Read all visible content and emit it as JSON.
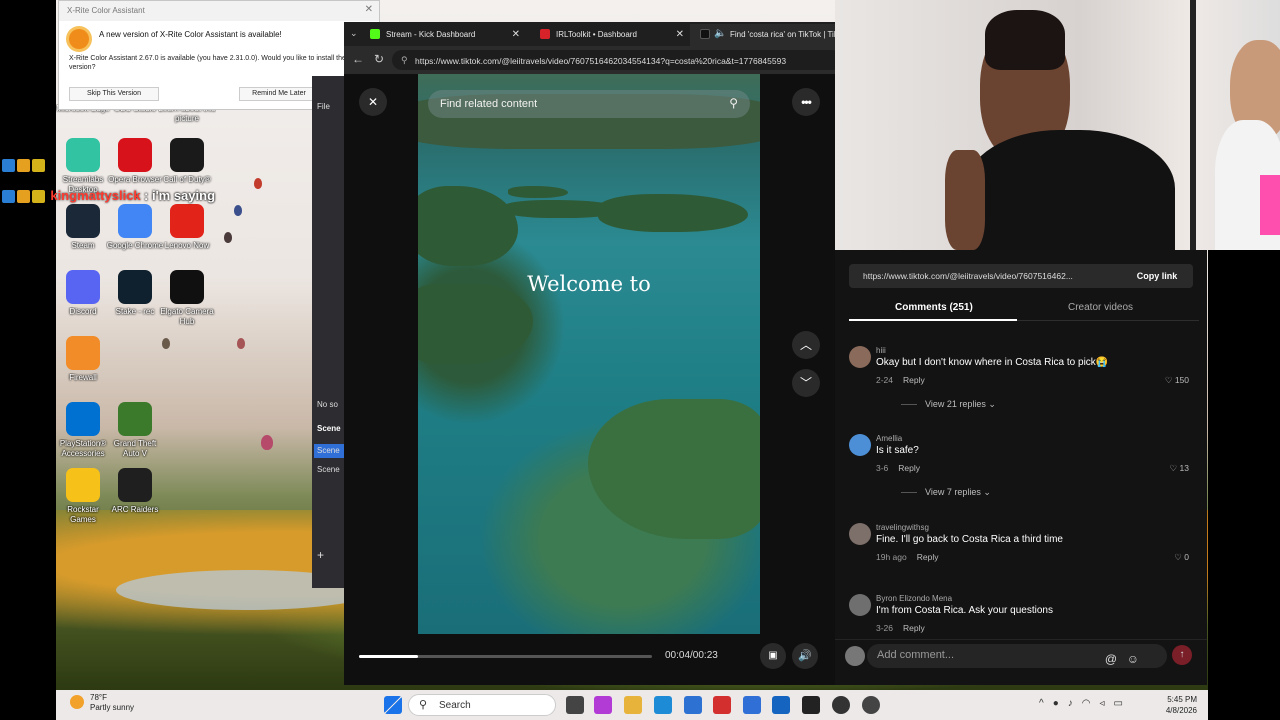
{
  "xrite_popup": {
    "title": "X-Rite Color Assistant",
    "headline": "A new version of X-Rite Color Assistant is available!",
    "body": "X-Rite Color Assistant 2.67.0 is available (you have 2.31.0.0). Would you like to install the newer version?",
    "skip_button": "Skip This Version",
    "remind_button": "Remind Me Later"
  },
  "desktop_icons": [
    {
      "label": "Microsoft Edge",
      "icon": "edge-icon",
      "color": "#1a6fb5"
    },
    {
      "label": "OBS Studio",
      "icon": "obs-icon",
      "color": "#302e31"
    },
    {
      "label": "Learn about this picture",
      "icon": "picture-icon",
      "color": "#3a7bd5"
    },
    {
      "label": "Streamlabs Desktop",
      "icon": "streamlabs-icon",
      "color": "#31c3a2"
    },
    {
      "label": "Opera Browser",
      "icon": "opera-icon",
      "color": "#d7121b"
    },
    {
      "label": "Call of Duty®",
      "icon": "callofduty-icon",
      "color": "#1a1a1a"
    },
    {
      "label": "Steam",
      "icon": "steam-icon",
      "color": "#1b2838"
    },
    {
      "label": "Google Chrome",
      "icon": "chrome-icon",
      "color": "#4285f4"
    },
    {
      "label": "Lenovo Now",
      "icon": "lenovo-icon",
      "color": "#e2231a"
    },
    {
      "label": "Discord",
      "icon": "discord-icon",
      "color": "#5865f2"
    },
    {
      "label": "Stake - rec",
      "icon": "stake-icon",
      "color": "#0f212e"
    },
    {
      "label": "Elgato Camera Hub",
      "icon": "webcam-icon",
      "color": "#101010"
    },
    {
      "label": "Firewall",
      "icon": "firewall-icon",
      "color": "#f28c28"
    },
    {
      "label": "PlayStation® Accessories",
      "icon": "playstation-icon",
      "color": "#0070d1"
    },
    {
      "label": "Grand Theft Auto V",
      "icon": "gta-icon",
      "color": "#3b7a2b"
    },
    {
      "label": "Rockstar Games",
      "icon": "rockstar-icon",
      "color": "#f6c21a"
    },
    {
      "label": "ARC Raiders",
      "icon": "arcraiders-icon",
      "color": "#1f1f1f"
    }
  ],
  "chat": [
    {
      "user": "",
      "text": ": i'm saying",
      "user2": "kingmattyslick"
    }
  ],
  "obs": {
    "file_menu": "File",
    "no_source": "No so",
    "scenes": "Scene",
    "scene1": "Scene",
    "scene2": "Scene",
    "add": "+"
  },
  "browser": {
    "tabs": [
      {
        "label": "Stream - Kick Dashboard",
        "color": "#53fc18"
      },
      {
        "label": "IRLToolkit • Dashboard",
        "color": "#d8222a"
      },
      {
        "label": "Find 'costa rica' on TikTok | TikTok",
        "color": "#111111"
      }
    ],
    "url": "https://www.tiktok.com/@leiitravels/video/7607516462034554134?q=costa%20rica&t=1776845593"
  },
  "video": {
    "search_placeholder": "Find related content",
    "overlay_text": "Welcome to",
    "time": "00:04/00:23",
    "progress": 0.2
  },
  "comments_panel": {
    "link": "https://www.tiktok.com/@leiitravels/video/7607516462...",
    "copy_label": "Copy link",
    "tab_comments": "Comments (251)",
    "tab_creator": "Creator videos",
    "comments": [
      {
        "name": "hiii",
        "text": "Okay but I don't know where in Costa Rica to pick😭",
        "date": "2-24",
        "reply": "Reply",
        "likes": "150",
        "view_replies": "View 21 replies",
        "avatar_color": "#8a6a5a"
      },
      {
        "name": "Amellia",
        "text": "Is it safe?",
        "date": "3-6",
        "reply": "Reply",
        "likes": "13",
        "view_replies": "View 7 replies",
        "avatar_color": "#4d8fd6"
      },
      {
        "name": "travelingwithsg",
        "text": "Fine. I'll go back to Costa Rica a third time",
        "date": "19h ago",
        "reply": "Reply",
        "likes": "0",
        "view_replies": "",
        "avatar_color": "#7d6f6a"
      },
      {
        "name": "Byron Elizondo Mena",
        "text": "I'm from Costa Rica. Ask your questions",
        "date": "3-26",
        "reply": "Reply",
        "likes": "",
        "view_replies": "",
        "avatar_color": "#6f6f6f"
      }
    ],
    "add_comment_placeholder": "Add comment..."
  },
  "taskbar": {
    "temp": "78°F",
    "weather": "Partly sunny",
    "search": "Search",
    "time": "5:45 PM",
    "date": "4/8/2026"
  }
}
